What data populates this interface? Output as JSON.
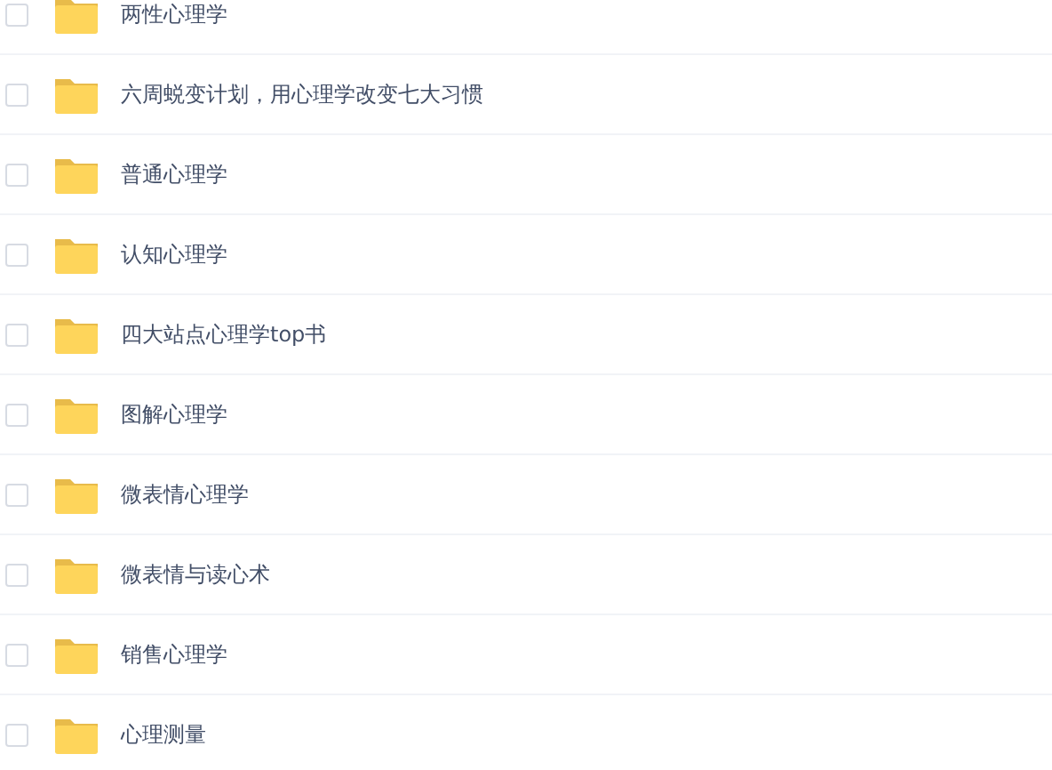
{
  "files": [
    {
      "name": "两性心理学",
      "checked": false
    },
    {
      "name": "六周蜕变计划，用心理学改变七大习惯",
      "checked": false
    },
    {
      "name": "普通心理学",
      "checked": false
    },
    {
      "name": "认知心理学",
      "checked": false
    },
    {
      "name": "四大站点心理学top书",
      "checked": false
    },
    {
      "name": "图解心理学",
      "checked": false
    },
    {
      "name": "微表情心理学",
      "checked": false
    },
    {
      "name": "微表情与读心术",
      "checked": false
    },
    {
      "name": "销售心理学",
      "checked": false
    },
    {
      "name": "心理测量",
      "checked": false
    }
  ]
}
